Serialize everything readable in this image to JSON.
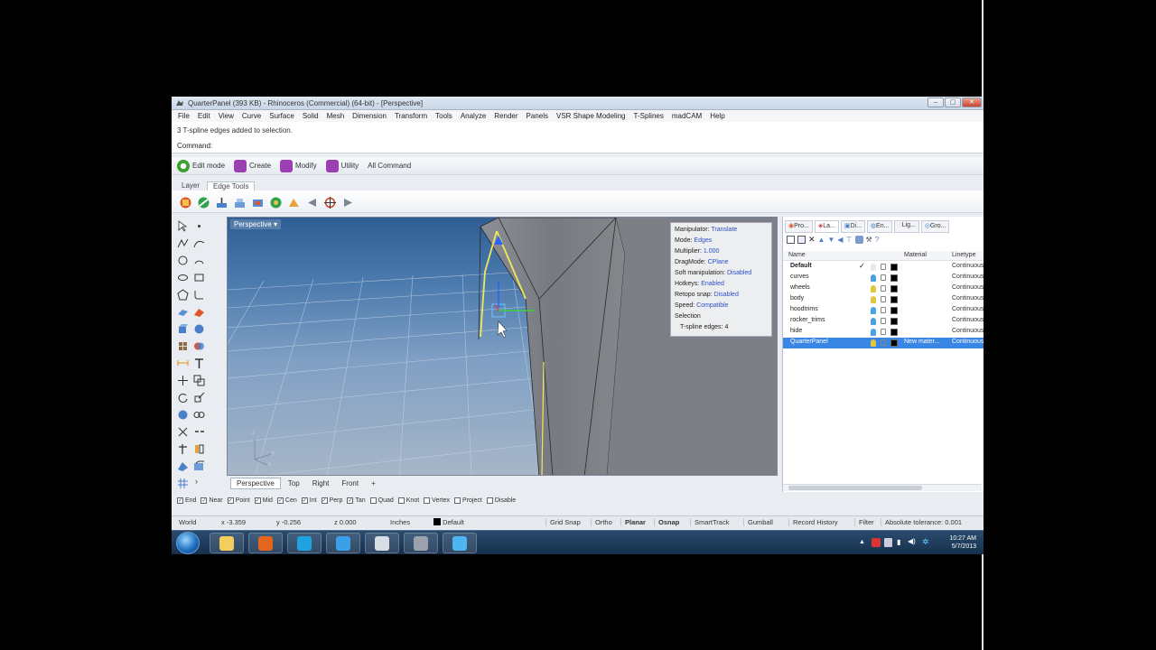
{
  "window": {
    "title": "QuarterPanel (393 KB) - Rhinoceros (Commercial) (64-bit) - [Perspective]",
    "buttons": [
      "–",
      "▢",
      "✕"
    ]
  },
  "menu": [
    "File",
    "Edit",
    "View",
    "Curve",
    "Surface",
    "Solid",
    "Mesh",
    "Dimension",
    "Transform",
    "Tools",
    "Analyze",
    "Render",
    "Panels",
    "VSR Shape Modeling",
    "T-Splines",
    "madCAM",
    "Help"
  ],
  "command": {
    "history": "3 T-spline edges added to selection.",
    "prompt": "Command:",
    "value": ""
  },
  "tsplines_toolbar": [
    {
      "label": "Edit mode",
      "icon": "power-icon",
      "color": "#3aa12f"
    },
    {
      "label": "Create",
      "icon": "create-icon",
      "color": "#9b3fb3"
    },
    {
      "label": "Modify",
      "icon": "modify-icon",
      "color": "#9b3fb3"
    },
    {
      "label": "Utility",
      "icon": "utility-icon",
      "color": "#9b3fb3"
    },
    {
      "label": "All Command",
      "icon": "",
      "color": ""
    }
  ],
  "tool_tabs": [
    "Layer",
    "Edge Tools"
  ],
  "viewport": {
    "title": "Perspective",
    "tabs": [
      "Perspective",
      "Top",
      "Right",
      "Front"
    ],
    "add_tab": "+",
    "axis_z": "z",
    "axis_y": "y",
    "axis_x": "x"
  },
  "manipulator_info": [
    {
      "label": "Manipulator:",
      "value": "Translate"
    },
    {
      "label": "Mode:",
      "value": "Edges"
    },
    {
      "label": "Multiplier:",
      "value": "1.000"
    },
    {
      "label": "DragMode:",
      "value": "CPlane"
    },
    {
      "label": "Soft manipulation:",
      "value": "Disabled"
    },
    {
      "label": "Hotkeys:",
      "value": "Enabled"
    },
    {
      "label": "Retopo snap:",
      "value": "Disabled"
    },
    {
      "label": "Speed:",
      "value": "Compatible"
    },
    {
      "label": "Selection",
      "value": ""
    },
    {
      "label": "T-spline edges:",
      "value": "4"
    }
  ],
  "osnaps": [
    {
      "label": "End",
      "checked": true
    },
    {
      "label": "Near",
      "checked": true
    },
    {
      "label": "Point",
      "checked": true
    },
    {
      "label": "Mid",
      "checked": true
    },
    {
      "label": "Cen",
      "checked": true
    },
    {
      "label": "Int",
      "checked": true
    },
    {
      "label": "Perp",
      "checked": true
    },
    {
      "label": "Tan",
      "checked": true
    },
    {
      "label": "Quad",
      "checked": false
    },
    {
      "label": "Knot",
      "checked": false
    },
    {
      "label": "Vertex",
      "checked": false
    },
    {
      "label": "Project",
      "checked": false
    },
    {
      "label": "Disable",
      "checked": false
    }
  ],
  "status": {
    "cplane": "World",
    "x": "x -3.359",
    "y": "y -0.256",
    "z": "z 0.000",
    "units": "Inches",
    "layer": "Default",
    "buttons": [
      "Grid Snap",
      "Ortho",
      "Planar",
      "Osnap",
      "SmartTrack",
      "Gumball",
      "Record History",
      "Filter"
    ],
    "tolerance": "Absolute tolerance: 0.001"
  },
  "panel": {
    "tabs": [
      "Pro...",
      "La...",
      "Di...",
      "En...",
      "Lig...",
      "Gro..."
    ],
    "columns": {
      "name": "Name",
      "material": "Material",
      "linetype": "Linetype"
    },
    "layers": [
      {
        "name": "Default",
        "current": true,
        "bulb": "#e8e8e8",
        "color": "#000000",
        "material": "",
        "linetype": "Continuous",
        "selected": false
      },
      {
        "name": "curves",
        "current": false,
        "bulb": "#4aa3e0",
        "color": "#000000",
        "material": "",
        "linetype": "Continuous",
        "selected": false
      },
      {
        "name": "wheels",
        "current": false,
        "bulb": "#e2c640",
        "color": "#000000",
        "material": "",
        "linetype": "Continuous",
        "selected": false
      },
      {
        "name": "body",
        "current": false,
        "bulb": "#e2c640",
        "color": "#000000",
        "material": "",
        "linetype": "Continuous",
        "selected": false
      },
      {
        "name": "hoodtrims",
        "current": false,
        "bulb": "#4aa3e0",
        "color": "#000000",
        "material": "",
        "linetype": "Continuous",
        "selected": false
      },
      {
        "name": "rocker_trims",
        "current": false,
        "bulb": "#4aa3e0",
        "color": "#000000",
        "material": "",
        "linetype": "Continuous",
        "selected": false
      },
      {
        "name": "hide",
        "current": false,
        "bulb": "#4aa3e0",
        "color": "#000000",
        "material": "",
        "linetype": "Continuous",
        "selected": false
      },
      {
        "name": "QuarterPanel",
        "current": false,
        "bulb": "#e2c640",
        "color": "#000000",
        "material": "New mater...",
        "linetype": "Continuous",
        "selected": true
      }
    ]
  },
  "taskbar": {
    "apps": [
      {
        "name": "explorer-app",
        "color": "#f2cf5c"
      },
      {
        "name": "firefox-app",
        "color": "#e2661e"
      },
      {
        "name": "skype-app",
        "color": "#1ea2e2"
      },
      {
        "name": "ie-app",
        "color": "#3aa0e8"
      },
      {
        "name": "document-app",
        "color": "#d9dde4"
      },
      {
        "name": "rhino-app",
        "color": "#9aa3ad"
      },
      {
        "name": "tsplines-app",
        "color": "#4db6f0"
      }
    ],
    "time": "10:27 AM",
    "date": "5/7/2013"
  }
}
